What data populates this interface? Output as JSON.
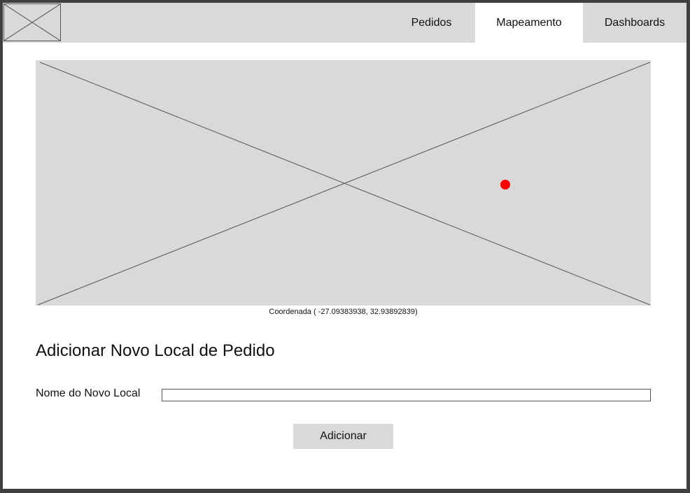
{
  "navbar": {
    "logo_icon": "image-placeholder-icon",
    "tabs": [
      {
        "label": "Pedidos",
        "active": false
      },
      {
        "label": "Mapeamento",
        "active": true
      },
      {
        "label": "Dashboards",
        "active": false
      }
    ]
  },
  "map": {
    "placeholder_icon": "image-placeholder-icon",
    "marker_color": "#ff0000",
    "coordinate_text": "Coordenada ( -27.09383938, 32.93892839)"
  },
  "form": {
    "title": "Adicionar Novo Local de Pedido",
    "name_label": "Nome do Novo Local",
    "name_value": "",
    "name_placeholder": "",
    "submit_label": "Adicionar"
  },
  "colors": {
    "placeholder_bg": "#d9d9d9",
    "marker": "#ff0000"
  }
}
